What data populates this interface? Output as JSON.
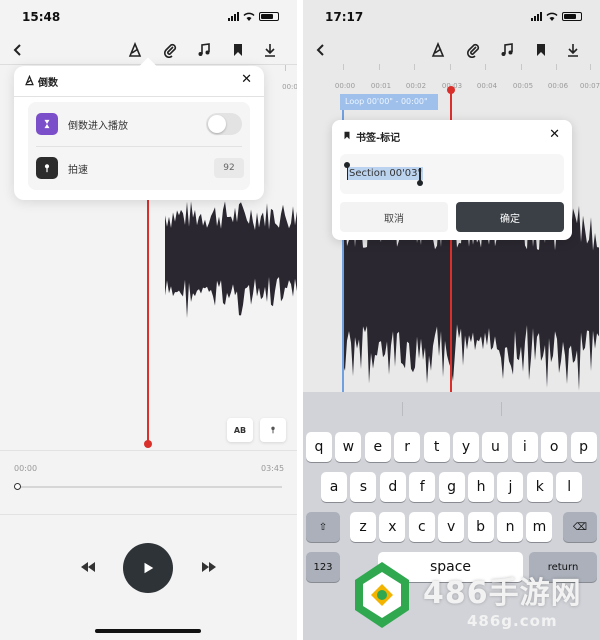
{
  "left_screen": {
    "status_time": "15:48",
    "popover": {
      "title": "倒数",
      "close": "✕",
      "rows": [
        {
          "label": "倒数进入播放",
          "toggle_on": false
        },
        {
          "label": "拍速",
          "value": "92"
        }
      ]
    },
    "ab_button": "AB",
    "time_start": "00:00",
    "time_end": "03:45",
    "scrub_position": 0.0
  },
  "right_screen": {
    "status_time": "17:17",
    "ruler_labels": [
      "00:00",
      "00:01",
      "00:02",
      "00:03",
      "00:04",
      "00:05",
      "00:06",
      "00:07"
    ],
    "loop_label": "Loop 00'00\" - 00:00\"",
    "dialog": {
      "title": "书签-标记",
      "close": "✕",
      "input_value": "Section 00'03\"",
      "cancel": "取消",
      "confirm": "确定"
    },
    "keyboard": {
      "row1": [
        "q",
        "w",
        "e",
        "r",
        "t",
        "y",
        "u",
        "i",
        "o",
        "p"
      ],
      "row2": [
        "a",
        "s",
        "d",
        "f",
        "g",
        "h",
        "j",
        "k",
        "l"
      ],
      "row3": [
        "z",
        "x",
        "c",
        "v",
        "b",
        "n",
        "m"
      ],
      "num_key": "123",
      "space_key": "space",
      "return_key": "return"
    }
  },
  "left_ruler_labels": [
    "00:0"
  ],
  "watermark": {
    "brand": "486手游网",
    "url": "486g.com"
  },
  "colors": {
    "playhead": "#d9302c",
    "loop": "#9ec0ea",
    "waveform": "#2a2730",
    "accent_purple": "#7b4fc9"
  }
}
